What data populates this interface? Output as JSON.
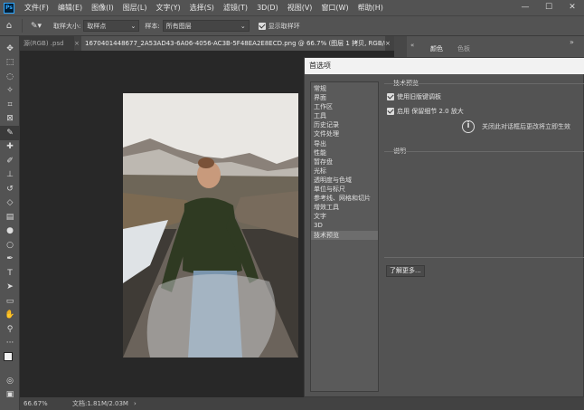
{
  "menu": {
    "items": [
      "文件(F)",
      "编辑(E)",
      "图像(I)",
      "图层(L)",
      "文字(Y)",
      "选择(S)",
      "滤镜(T)",
      "3D(D)",
      "视图(V)",
      "窗口(W)",
      "帮助(H)"
    ]
  },
  "options": {
    "sample_size_label": "取样大小:",
    "sample_size_value": "取样点",
    "sample_label": "样本:",
    "sample_value": "所有图层",
    "show_ring_label": "显示取样环"
  },
  "tabs": {
    "first": "源(RGB) .psd",
    "active": "1670401448677_2A53AD43-6A06-4056-AC3B-5F48EA2E8ECD.png @ 66.7% (图层 1 拷贝, RGB/8) *"
  },
  "status": {
    "zoom": "66.67%",
    "doc": "文档:1.81M/2.03M"
  },
  "panels": {
    "tab_color": "颜色",
    "tab_swatches": "色板"
  },
  "dialog": {
    "title": "首选项",
    "categories": [
      "常规",
      "界面",
      "工作区",
      "工具",
      "历史记录",
      "文件处理",
      "导出",
      "性能",
      "暂存盘",
      "光标",
      "透明度与色域",
      "单位与标尺",
      "参考线、网格和切片",
      "增效工具",
      "文字",
      "3D",
      "技术预览"
    ],
    "selected_index": 16,
    "section_title": "技术预览",
    "option1": "使用旧版键调板",
    "option2": "启用 保留细节 2.0 放大",
    "info_note": "关闭此对话框后更改将立即生效",
    "desc_title": "说明",
    "more_button": "了解更多..."
  }
}
